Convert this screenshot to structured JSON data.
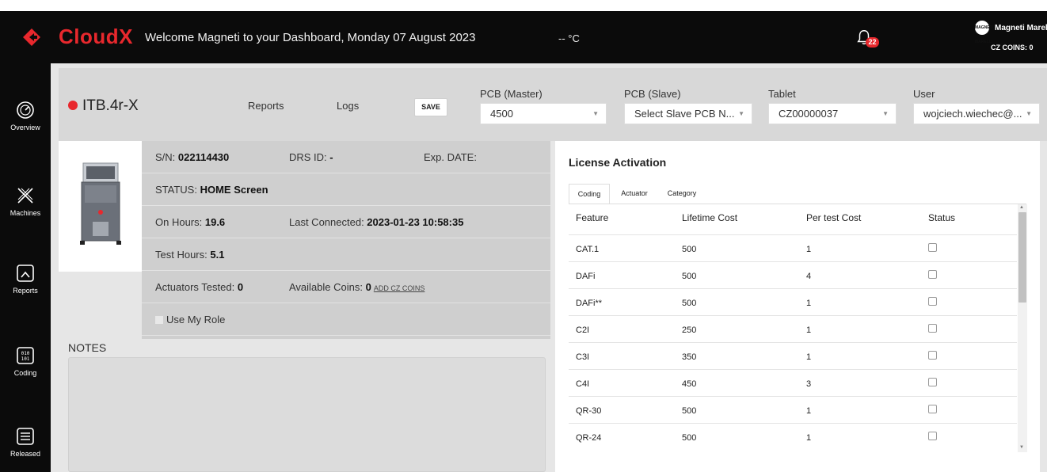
{
  "header": {
    "brand": "CloudX",
    "welcome": "Welcome Magneti to your Dashboard, Monday 07 August 2023",
    "temperature": "-- °C",
    "notification_count": "22",
    "company_logo_text": "MAGNETI MARELLI",
    "company_name": "Magneti Marelli",
    "coins": "CZ COINS: 0"
  },
  "sidebar": {
    "items": [
      {
        "label": "Overview",
        "icon": "gauge-icon"
      },
      {
        "label": "Machines",
        "icon": "x-logo-icon"
      },
      {
        "label": "Reports",
        "icon": "chart-icon"
      },
      {
        "label": "Coding",
        "icon": "binary-icon"
      },
      {
        "label": "Released",
        "icon": "list-icon"
      }
    ]
  },
  "machine": {
    "name": "ITB.4r-X",
    "status_color": "#e8282d",
    "links": {
      "reports": "Reports",
      "logs": "Logs"
    },
    "save_label": "SAVE"
  },
  "selects": {
    "pcb_master": {
      "label": "PCB (Master)",
      "value": "4500"
    },
    "pcb_slave": {
      "label": "PCB (Slave)",
      "value": "Select Slave PCB N..."
    },
    "tablet": {
      "label": "Tablet",
      "value": "CZ00000037"
    },
    "user": {
      "label": "User",
      "value": "wojciech.wiechec@..."
    }
  },
  "info": {
    "sn_label": "S/N: ",
    "sn": "022114430",
    "drs_label": "DRS ID: ",
    "drs": "-",
    "exp_label": "Exp. DATE:",
    "status_label": "STATUS: ",
    "status": "HOME Screen",
    "on_hours_label": "On Hours: ",
    "on_hours": "19.6",
    "last_connected_label": "Last Connected: ",
    "last_connected": "2023-01-23 10:58:35",
    "test_hours_label": "Test Hours: ",
    "test_hours": "5.1",
    "actuators_label": "Actuators Tested: ",
    "actuators": "0",
    "available_coins_label": "Available Coins: ",
    "available_coins": "0",
    "add_coins": "ADD CZ COINS",
    "use_role": "Use My Role"
  },
  "notes": {
    "label": "NOTES",
    "value": ""
  },
  "license": {
    "title": "License Activation",
    "tabs": [
      "Coding",
      "Actuator",
      "Category"
    ],
    "active_tab": "Coding",
    "columns": [
      "Feature",
      "Lifetime Cost",
      "Per test Cost",
      "Status"
    ],
    "rows": [
      {
        "feature": "CAT.1",
        "lifetime": "500",
        "per_test": "1",
        "status": false
      },
      {
        "feature": "DAFi",
        "lifetime": "500",
        "per_test": "4",
        "status": false
      },
      {
        "feature": "DAFi**",
        "lifetime": "500",
        "per_test": "1",
        "status": false
      },
      {
        "feature": "C2I",
        "lifetime": "250",
        "per_test": "1",
        "status": false
      },
      {
        "feature": "C3I",
        "lifetime": "350",
        "per_test": "1",
        "status": false
      },
      {
        "feature": "C4I",
        "lifetime": "450",
        "per_test": "3",
        "status": false
      },
      {
        "feature": "QR-30",
        "lifetime": "500",
        "per_test": "1",
        "status": false
      },
      {
        "feature": "QR-24",
        "lifetime": "500",
        "per_test": "1",
        "status": false
      }
    ]
  },
  "colors": {
    "accent": "#e8282d",
    "sidebar": "#0b0b0b"
  }
}
